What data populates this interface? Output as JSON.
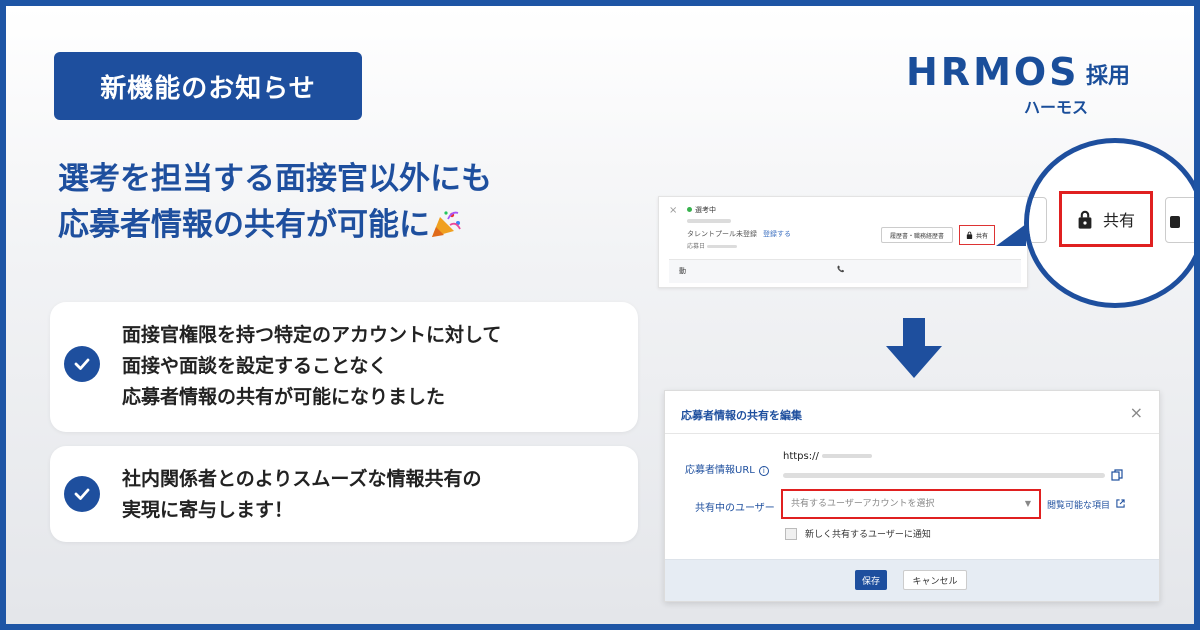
{
  "badge": "新機能のお知らせ",
  "logo": {
    "main": "HRMOS",
    "sub": "採用",
    "kana": "ハーモス"
  },
  "headline": {
    "line1": "選考を担当する面接官以外にも",
    "line2": "応募者情報の共有が可能に"
  },
  "points": [
    {
      "lines": [
        "面接官権限を持つ特定のアカウントに対して",
        "面接や面談を設定することなく",
        "応募者情報の共有が可能になりました"
      ]
    },
    {
      "lines": [
        "社内関係者とのよりスムーズな情報共有の",
        "実現に寄与します！"
      ]
    }
  ],
  "shot1": {
    "close": "×",
    "status": "選考中",
    "talent": "タレントプール未登録",
    "register": "登録する",
    "apply": "応募日",
    "resume_button": "履歴書・職務経歴書",
    "share_button": "共有",
    "bottom_left": "動",
    "bottom_right": "📞"
  },
  "magnifier": {
    "share_label": "共有"
  },
  "dialog": {
    "title": "応募者情報の共有を編集",
    "close": "×",
    "url_label": "応募者情報URL",
    "info": "i",
    "url_value": "https://",
    "shared_users_label": "共有中のユーザー",
    "select_placeholder": "共有するユーザーアカウントを選択",
    "viewable_items": "閲覧可能な項目",
    "notify_label": "新しく共有するユーザーに通知",
    "save": "保存",
    "cancel": "キャンセル"
  },
  "colors": {
    "brand": "#1e4f9e",
    "highlight": "#e02020"
  }
}
